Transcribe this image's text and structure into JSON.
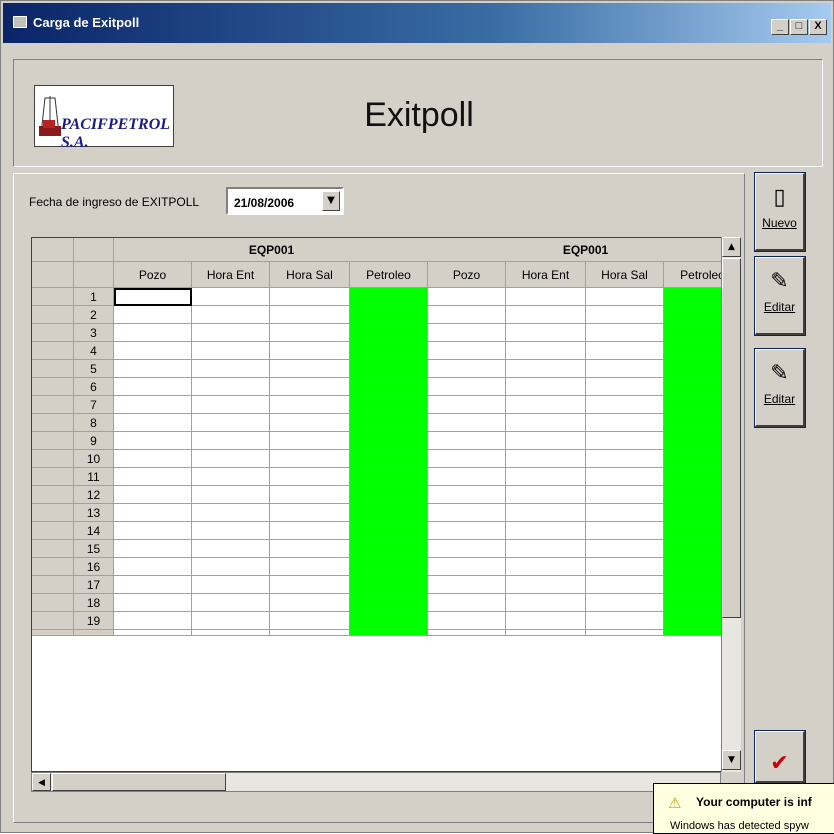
{
  "window": {
    "title": "Carga de Exitpoll",
    "buttons": [
      "_",
      "□",
      "X"
    ]
  },
  "header": {
    "logo_text": "PACIFPETROL S.A.",
    "title": "Exitpoll"
  },
  "date": {
    "label": "Fecha de ingreso de EXITPOLL",
    "value": "21/08/2006"
  },
  "grid": {
    "groups": [
      "EQP001",
      "EQP001"
    ],
    "columns": [
      "Pozo",
      "Hora Ent",
      "Hora Sal",
      "Petroleo",
      "Pozo",
      "Hora Ent",
      "Hora Sal",
      "Petroleo"
    ],
    "rows": [
      "1",
      "2",
      "3",
      "4",
      "5",
      "6",
      "7",
      "8",
      "9",
      "10",
      "11",
      "12",
      "13",
      "14",
      "15",
      "16",
      "17",
      "18",
      "19"
    ],
    "highlight_color": "#00ff00"
  },
  "buttons": {
    "nuevo": "Nuevo",
    "editar1": "Editar",
    "editar2": "Editar",
    "ok_icon": "checkmark-icon"
  },
  "balloon": {
    "title": "Your computer is inf",
    "text": "Windows has detected spyw"
  }
}
